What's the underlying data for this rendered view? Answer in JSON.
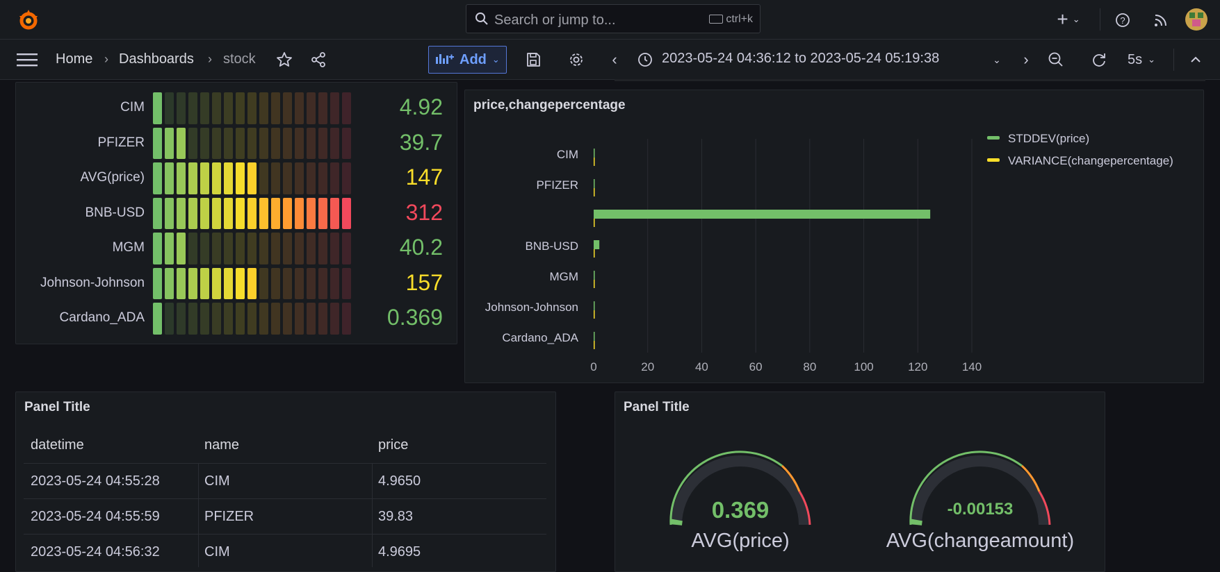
{
  "topbar": {
    "search_placeholder": "Search or jump to...",
    "search_shortcut": "ctrl+k"
  },
  "nav": {
    "breadcrumbs": [
      "Home",
      "Dashboards",
      "stock"
    ],
    "add_label": "Add",
    "time_range": "2023-05-24 04:36:12 to 2023-05-24 05:19:38",
    "refresh_interval": "5s"
  },
  "bar_gauge": {
    "rows": [
      {
        "label": "CIM",
        "value": "4.92",
        "color": "#73bf69",
        "lit": 1
      },
      {
        "label": "PFIZER",
        "value": "39.7",
        "color": "#73bf69",
        "lit": 3
      },
      {
        "label": "AVG(price)",
        "value": "147",
        "color": "#fade2a",
        "lit": 9
      },
      {
        "label": "BNB-USD",
        "value": "312",
        "color": "#f2495c",
        "lit": 17
      },
      {
        "label": "MGM",
        "value": "40.2",
        "color": "#73bf69",
        "lit": 3
      },
      {
        "label": "Johnson-Johnson",
        "value": "157",
        "color": "#fade2a",
        "lit": 9
      },
      {
        "label": "Cardano_ADA",
        "value": "0.369",
        "color": "#73bf69",
        "lit": 1
      }
    ]
  },
  "bar_chart_panel": {
    "title": "price,changepercentage"
  },
  "chart_data": {
    "type": "bar",
    "orientation": "horizontal",
    "categories": [
      "CIM",
      "PFIZER",
      "",
      "BNB-USD",
      "MGM",
      "Johnson-Johnson",
      "Cardano_ADA"
    ],
    "series": [
      {
        "name": "STDDEV(price)",
        "color": "#73bf69",
        "values": [
          0.04,
          0.05,
          124.6,
          2.1,
          0.4,
          0.1,
          0.001
        ]
      },
      {
        "name": "VARIANCE(changepercentage)",
        "color": "#fade2a",
        "values": [
          0.2,
          0.3,
          0.2,
          0.3,
          0.2,
          0.2,
          0.2
        ]
      }
    ],
    "xlim": [
      0,
      140
    ],
    "xticks": [
      "0",
      "20",
      "40",
      "60",
      "80",
      "100",
      "120",
      "140"
    ],
    "grid": true,
    "legend_position": "top-right"
  },
  "table_panel": {
    "title": "Panel Title",
    "columns": [
      "datetime",
      "name",
      "price"
    ],
    "rows": [
      [
        "2023-05-24 04:55:28",
        "CIM",
        "4.9650"
      ],
      [
        "2023-05-24 04:55:59",
        "PFIZER",
        "39.83"
      ],
      [
        "2023-05-24 04:56:32",
        "CIM",
        "4.9695"
      ]
    ]
  },
  "gauge_panel": {
    "title": "Panel Title",
    "gauges": [
      {
        "value": "0.369",
        "label": "AVG(price)",
        "level": 0.0
      },
      {
        "value": "-0.00153",
        "label": "AVG(changeamount)",
        "level": 0.0
      }
    ]
  }
}
